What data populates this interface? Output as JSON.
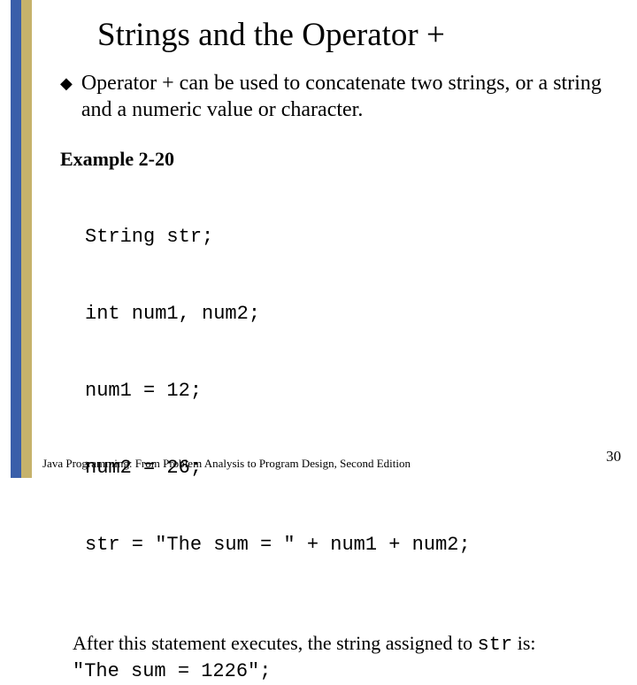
{
  "title": "Strings and the Operator +",
  "bullet": "Operator + can be used to concatenate two strings, or a string and a numeric value or character.",
  "example": {
    "label": "Example 2-20",
    "lines": [
      "String str;",
      "int num1, num2;",
      "num1 = 12;",
      "num2 = 26;",
      "str = \"The sum = \" + num1 + num2;"
    ]
  },
  "after": {
    "prefix": "After this statement executes, the string assigned to ",
    "var": "str",
    "suffix": " is:",
    "result": "\"The sum = 1226\";"
  },
  "footer": "Java Programming: From Problem Analysis to Program Design, Second Edition",
  "page": "30"
}
